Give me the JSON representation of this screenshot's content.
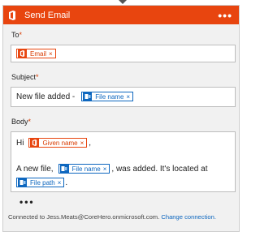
{
  "header": {
    "title": "Send Email",
    "more_label": "•••",
    "icon": "office-icon"
  },
  "fields": {
    "to": {
      "label": "To",
      "required_mark": "*",
      "token": {
        "label": "Email",
        "icon": "office-icon"
      }
    },
    "subject": {
      "label": "Subject",
      "required_mark": "*",
      "text": "New file added -",
      "token": {
        "label": "File name",
        "icon": "sharepoint-icon"
      }
    },
    "body": {
      "label": "Body",
      "required_mark": "*",
      "line1_prefix": "Hi",
      "token_given_name": {
        "label": "Given name",
        "icon": "office-icon"
      },
      "line1_suffix": ",",
      "line2_prefix": "A new file,",
      "token_file_name": {
        "label": "File name",
        "icon": "sharepoint-icon"
      },
      "line2_suffix": ", was added. It's located at",
      "token_file_path": {
        "label": "File path",
        "icon": "sharepoint-icon"
      },
      "line3_suffix": "."
    }
  },
  "token_remove": "×",
  "more_options": "•••",
  "footer": {
    "connected_text": "Connected to Jess.Meats@CoreHero.onmicrosoft.com.",
    "change_link": "Change connection."
  },
  "colors": {
    "office": "#e8450f",
    "sharepoint": "#0e67bf"
  }
}
